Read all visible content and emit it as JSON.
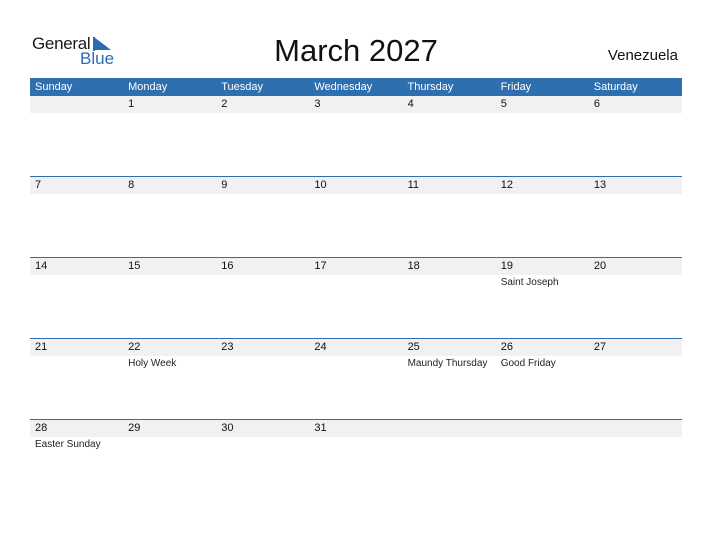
{
  "logo": {
    "general": "General",
    "blue": "Blue"
  },
  "title": "March 2027",
  "country": "Venezuela",
  "colors": {
    "accent": "#2e6fb0",
    "strip": "#f1f1f1"
  },
  "weekdays": [
    "Sunday",
    "Monday",
    "Tuesday",
    "Wednesday",
    "Thursday",
    "Friday",
    "Saturday"
  ],
  "weeks": [
    [
      {
        "day": ""
      },
      {
        "day": "1"
      },
      {
        "day": "2"
      },
      {
        "day": "3"
      },
      {
        "day": "4"
      },
      {
        "day": "5"
      },
      {
        "day": "6"
      }
    ],
    [
      {
        "day": "7"
      },
      {
        "day": "8"
      },
      {
        "day": "9"
      },
      {
        "day": "10"
      },
      {
        "day": "11"
      },
      {
        "day": "12"
      },
      {
        "day": "13"
      }
    ],
    [
      {
        "day": "14"
      },
      {
        "day": "15"
      },
      {
        "day": "16"
      },
      {
        "day": "17"
      },
      {
        "day": "18"
      },
      {
        "day": "19",
        "holiday": "Saint Joseph"
      },
      {
        "day": "20"
      }
    ],
    [
      {
        "day": "21"
      },
      {
        "day": "22",
        "holiday": "Holy Week"
      },
      {
        "day": "23"
      },
      {
        "day": "24"
      },
      {
        "day": "25",
        "holiday": "Maundy Thursday"
      },
      {
        "day": "26",
        "holiday": "Good Friday"
      },
      {
        "day": "27"
      }
    ],
    [
      {
        "day": "28",
        "holiday": "Easter Sunday"
      },
      {
        "day": "29"
      },
      {
        "day": "30"
      },
      {
        "day": "31"
      },
      {
        "day": ""
      },
      {
        "day": ""
      },
      {
        "day": ""
      }
    ]
  ]
}
